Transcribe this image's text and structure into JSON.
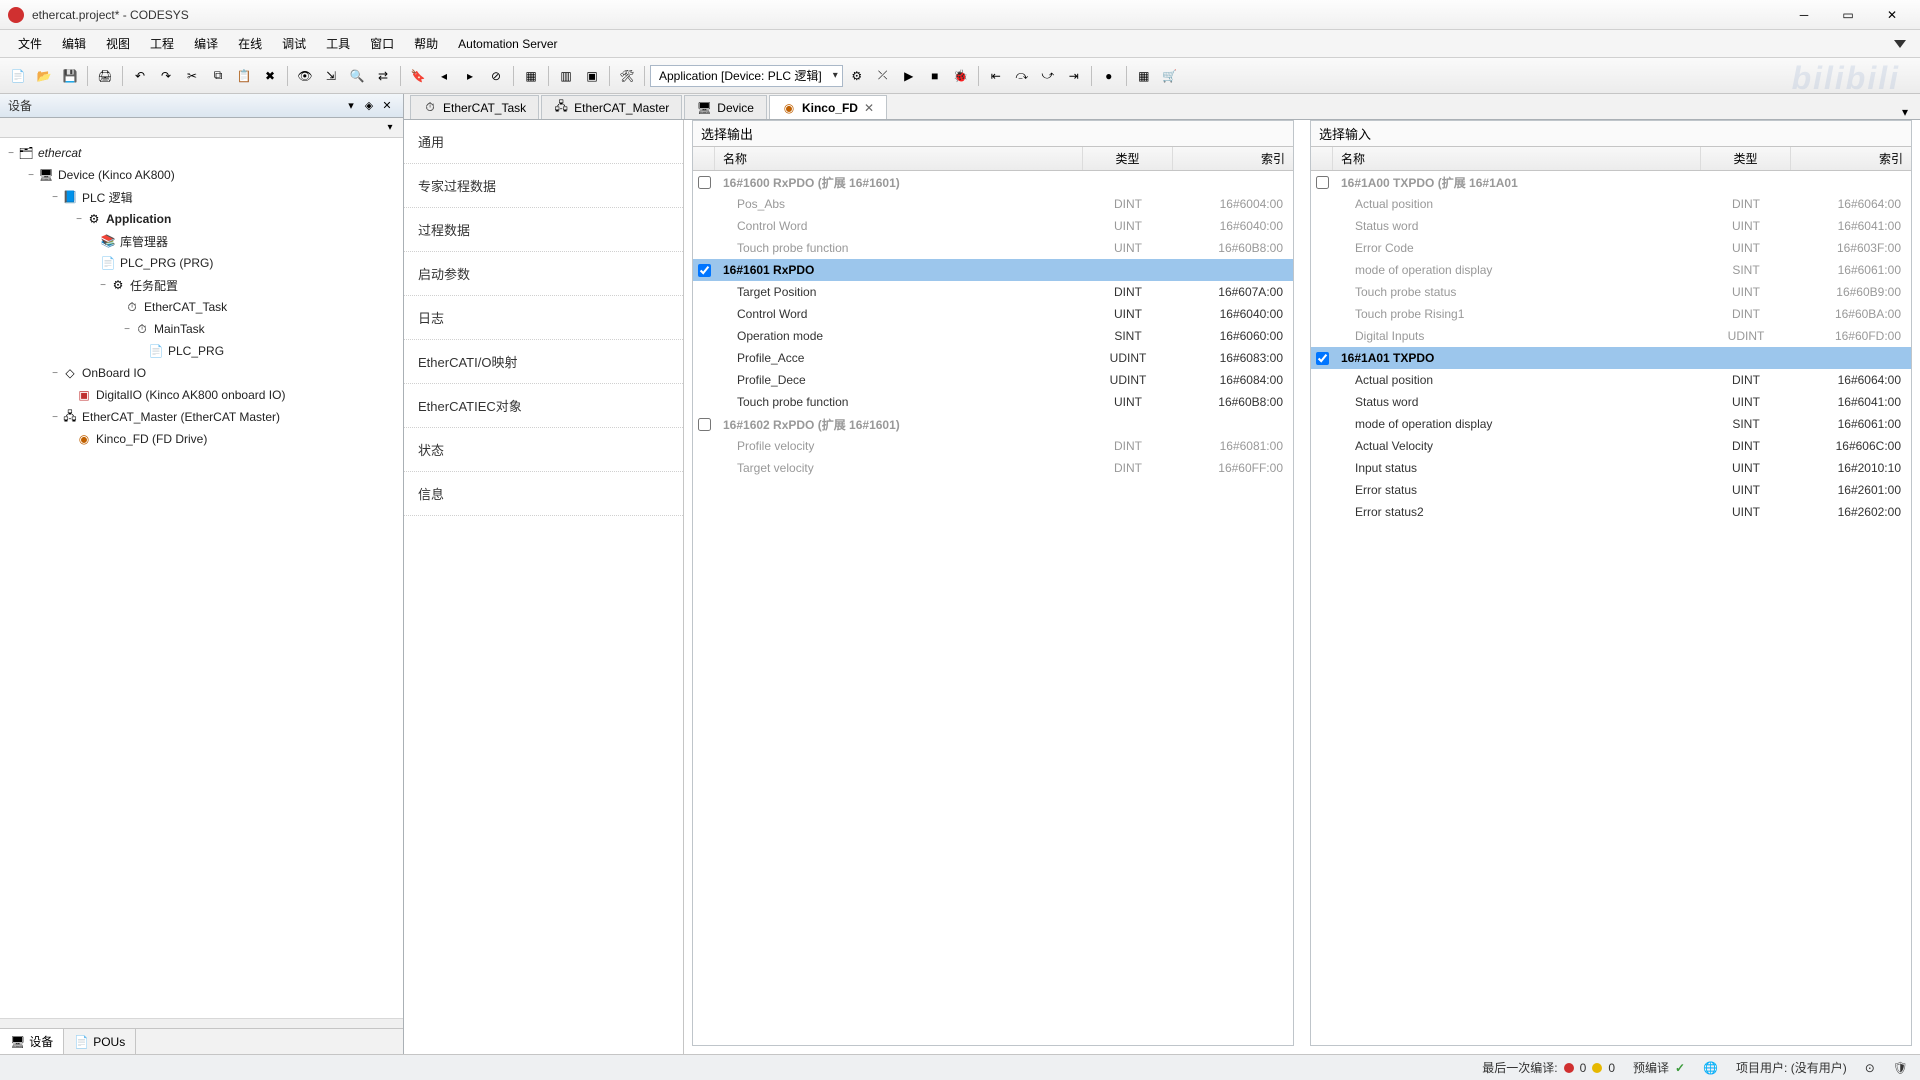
{
  "window": {
    "title": "ethercat.project* - CODESYS"
  },
  "menu": [
    "文件",
    "编辑",
    "视图",
    "工程",
    "编译",
    "在线",
    "调试",
    "工具",
    "窗口",
    "帮助",
    "Automation Server"
  ],
  "toolbar_combo": "Application [Device: PLC 逻辑]",
  "device_panel": {
    "title": "设备"
  },
  "tree": {
    "root": "ethercat",
    "device": "Device (Kinco AK800)",
    "plc_logic": "PLC 逻辑",
    "application": "Application",
    "lib_mgr": "库管理器",
    "plc_prg_pou": "PLC_PRG (PRG)",
    "task_cfg": "任务配置",
    "ethercat_task": "EtherCAT_Task",
    "main_task": "MainTask",
    "plc_prg": "PLC_PRG",
    "onboard_io": "OnBoard IO",
    "digital_io": "DigitalIO (Kinco AK800 onboard IO)",
    "ethercat_master": "EtherCAT_Master (EtherCAT Master)",
    "kinco_fd": "Kinco_FD (FD Drive)"
  },
  "left_footer": {
    "devices": "设备",
    "pous": "POUs"
  },
  "editor_tabs": [
    {
      "label": "EtherCAT_Task",
      "active": false
    },
    {
      "label": "EtherCAT_Master",
      "active": false
    },
    {
      "label": "Device",
      "active": false
    },
    {
      "label": "Kinco_FD",
      "active": true
    }
  ],
  "side_nav": [
    "通用",
    "专家过程数据",
    "过程数据",
    "启动参数",
    "日志",
    "EtherCATI/O映射",
    "EtherCATIEC对象",
    "状态",
    "信息"
  ],
  "output_pane": {
    "title": "选择输出",
    "columns": {
      "name": "名称",
      "type": "类型",
      "index": "索引"
    },
    "groups": [
      {
        "label": "16#1600 RxPDO (扩展 16#1601)",
        "checked": false,
        "selected": false,
        "rows": [
          {
            "name": "Pos_Abs",
            "type": "DINT",
            "index": "16#6004:00"
          },
          {
            "name": "Control Word",
            "type": "UINT",
            "index": "16#6040:00"
          },
          {
            "name": "Touch probe function",
            "type": "UINT",
            "index": "16#60B8:00"
          }
        ]
      },
      {
        "label": "16#1601 RxPDO",
        "checked": true,
        "selected": true,
        "rows": [
          {
            "name": "Target Position",
            "type": "DINT",
            "index": "16#607A:00"
          },
          {
            "name": "Control Word",
            "type": "UINT",
            "index": "16#6040:00"
          },
          {
            "name": "Operation mode",
            "type": "SINT",
            "index": "16#6060:00"
          },
          {
            "name": "Profile_Acce",
            "type": "UDINT",
            "index": "16#6083:00"
          },
          {
            "name": "Profile_Dece",
            "type": "UDINT",
            "index": "16#6084:00"
          },
          {
            "name": "Touch probe function",
            "type": "UINT",
            "index": "16#60B8:00"
          }
        ]
      },
      {
        "label": "16#1602 RxPDO (扩展 16#1601)",
        "checked": false,
        "selected": false,
        "rows": [
          {
            "name": "Profile velocity",
            "type": "DINT",
            "index": "16#6081:00"
          },
          {
            "name": "Target velocity",
            "type": "DINT",
            "index": "16#60FF:00"
          }
        ]
      }
    ]
  },
  "input_pane": {
    "title": "选择输入",
    "columns": {
      "name": "名称",
      "type": "类型",
      "index": "索引"
    },
    "groups": [
      {
        "label": "16#1A00 TXPDO (扩展 16#1A01",
        "checked": false,
        "selected": false,
        "rows": [
          {
            "name": "Actual position",
            "type": "DINT",
            "index": "16#6064:00"
          },
          {
            "name": "Status word",
            "type": "UINT",
            "index": "16#6041:00"
          },
          {
            "name": "Error Code",
            "type": "UINT",
            "index": "16#603F:00"
          },
          {
            "name": "mode of operation display",
            "type": "SINT",
            "index": "16#6061:00"
          },
          {
            "name": "Touch probe status",
            "type": "UINT",
            "index": "16#60B9:00"
          },
          {
            "name": "Touch probe Rising1",
            "type": "DINT",
            "index": "16#60BA:00"
          },
          {
            "name": "Digital Inputs",
            "type": "UDINT",
            "index": "16#60FD:00"
          }
        ]
      },
      {
        "label": "16#1A01 TXPDO",
        "checked": true,
        "selected": true,
        "rows": [
          {
            "name": "Actual position",
            "type": "DINT",
            "index": "16#6064:00"
          },
          {
            "name": "Status word",
            "type": "UINT",
            "index": "16#6041:00"
          },
          {
            "name": "mode of operation display",
            "type": "SINT",
            "index": "16#6061:00"
          },
          {
            "name": "Actual Velocity",
            "type": "DINT",
            "index": "16#606C:00"
          },
          {
            "name": "Input status",
            "type": "UINT",
            "index": "16#2010:10"
          },
          {
            "name": "Error status",
            "type": "UINT",
            "index": "16#2601:00"
          },
          {
            "name": "Error status2",
            "type": "UINT",
            "index": "16#2602:00"
          }
        ]
      }
    ]
  },
  "status": {
    "compile_label": "最后一次编译:",
    "err_count": "0",
    "warn_count": "0",
    "precompile_label": "预编译",
    "user_label": "项目用户: (没有用户)"
  }
}
